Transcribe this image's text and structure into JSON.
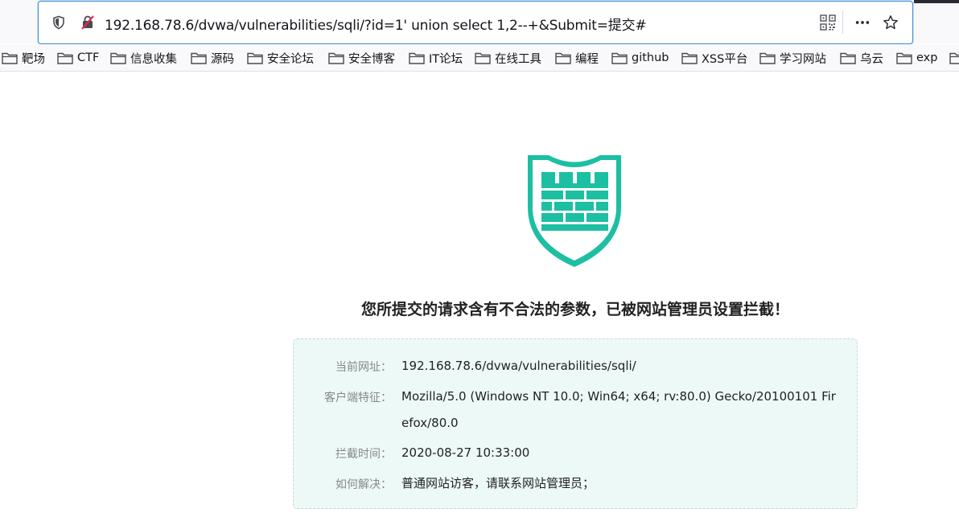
{
  "browser": {
    "url": "192.168.78.6/dvwa/vulnerabilities/sqli/?id=1' union select 1,2--+&Submit=提交#",
    "icons": {
      "tracking": "shield-icon",
      "connection": "insecure-lock-icon",
      "qr": "qr-code-icon",
      "more": "more-icon",
      "bookmark": "star-icon"
    },
    "bookmarks": [
      "靶场",
      "CTF",
      "信息收集",
      "源码",
      "安全论坛",
      "安全博客",
      "IT论坛",
      "在线工具",
      "编程",
      "github",
      "XSS平台",
      "学习网站",
      "乌云",
      "exp"
    ]
  },
  "page": {
    "title": "您所提交的请求含有不合法的参数，已被网站管理员设置拦截！",
    "logo_color": "#1dbfa3",
    "rows": [
      {
        "label": "当前网址：",
        "value": "192.168.78.6/dvwa/vulnerabilities/sqli/"
      },
      {
        "label": "客户端特征：",
        "value": "Mozilla/5.0 (Windows NT 10.0; Win64; x64; rv:80.0) Gecko/20100101 Firefox/80.0"
      },
      {
        "label": "拦截时间：",
        "value": "2020-08-27 10:33:00"
      },
      {
        "label": "如何解决：",
        "value": "普通网站访客，请联系网站管理员；"
      }
    ]
  }
}
